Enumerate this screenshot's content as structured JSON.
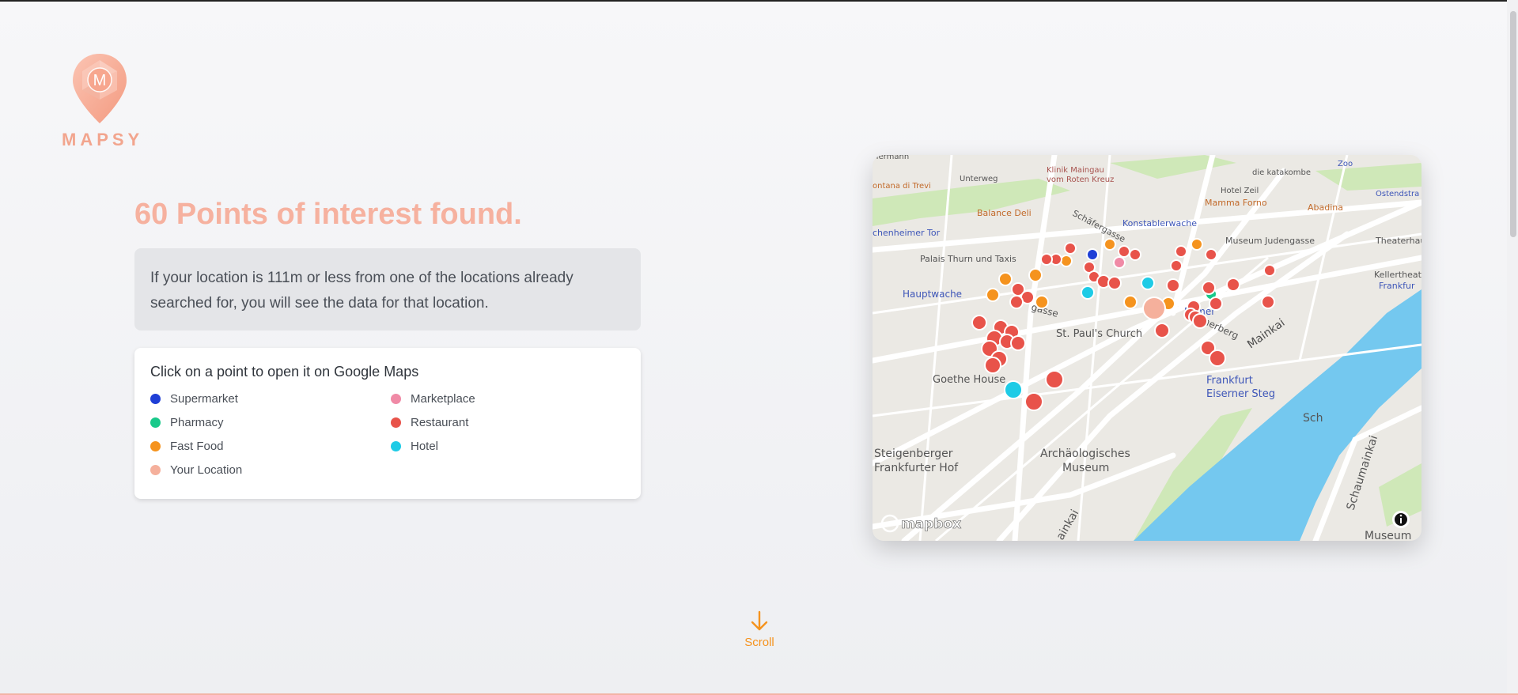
{
  "app": {
    "name": "MAPSY",
    "logo_letter": "M"
  },
  "headline": "60 Points of interest found.",
  "info_text": "If your location is 111m or less from one of the locations already searched for, you will see the data for that location.",
  "legend": {
    "title": "Click on a point to open it on Google Maps",
    "items": [
      {
        "label": "Supermarket",
        "color": "#1f3fd6"
      },
      {
        "label": "Marketplace",
        "color": "#f08aa6"
      },
      {
        "label": "Pharmacy",
        "color": "#19c98a"
      },
      {
        "label": "Restaurant",
        "color": "#e8534a"
      },
      {
        "label": "Fast Food",
        "color": "#f5931e"
      },
      {
        "label": "Hotel",
        "color": "#1ecbe6"
      },
      {
        "label": "Your Location",
        "color": "#f5b09c"
      }
    ]
  },
  "map": {
    "attribution": "mapbox",
    "labels": {
      "goethe": "Goethe House",
      "pauls": "St. Paul's Church",
      "archa1": "Archäologisches",
      "archa2": "Museum",
      "steig1": "Steigenberger",
      "steig2": "Frankfurter Hof",
      "frankfurt1": "Frankfurt",
      "frankfurt2": "Eiserner Steg",
      "hauptwache": "Hauptwache",
      "palais": "Palais Thurn und Taxis",
      "konstabler": "Konstablerwache",
      "judengasse": "Museum Judengasse",
      "mainkai": "Mainkai",
      "schaumainkai": "Schaumainkai",
      "balance": "Balance Deli",
      "mamma": "Mamma Forno",
      "abadina": "Abadina",
      "hotelzeil": "Hotel Zeil",
      "katakombe": "die katakombe",
      "klinik1": "Klinik Maingau",
      "klinik2": "vom Roten Kreuz",
      "unterweg": "Unterweg",
      "trevi": "ontana di Trevi",
      "eschenheimer": "chenheimer Tor",
      "zoo": "Zoo",
      "ostendstr": "Ostendstra",
      "theaterhaus": "Theaterhau",
      "kellertheater1": "Kellertheat",
      "kellertheater2": "Frankfur",
      "roemer": "Römer",
      "hermann": "Hermann",
      "schafergasse": "Schäfergasse",
      "tongasse": "gasse",
      "romerberg": "Römerberg",
      "mainkai2": "ainkai",
      "sch": "Sch",
      "museum": "Museum"
    }
  },
  "scroll_label": "Scroll"
}
